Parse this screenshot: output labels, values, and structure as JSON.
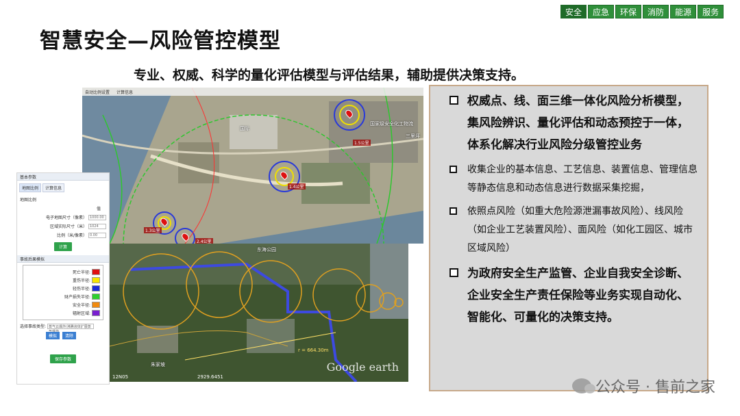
{
  "tabs": [
    "安全",
    "应急",
    "环保",
    "消防",
    "能源",
    "服务"
  ],
  "title": "智慧安全—风险管控模型",
  "subtitle": "专业、权威、科学的量化评估模型与评估结果，辅助提供决策支持。",
  "map_top": {
    "toolbar": [
      "自动比例设置",
      "计算信息"
    ],
    "labels": [
      "1.5公里",
      "1.4公里",
      "1.3公里",
      "2.4公里"
    ],
    "places": [
      "国家级安全化工物流",
      "国际",
      "三里坪"
    ]
  },
  "map_bottom": {
    "places": [
      "朱家坡",
      "东海公园"
    ],
    "distance": "r = 664.30m",
    "scale": "2929.6451",
    "coord": "12N05",
    "google": "Google earth"
  },
  "panel": {
    "header": "基本参数",
    "tabs": [
      "地图比例",
      "计算信息"
    ],
    "section": "地图比例",
    "col_label": "值",
    "rows": [
      {
        "label": "电子地图尺寸（像素）",
        "value": "1000.00"
      },
      {
        "label": "区域实际尺寸（米）",
        "value": "1024"
      },
      {
        "label": "比例（米/像素）",
        "value": "0.00"
      }
    ],
    "apply_btn": "计算",
    "legend_header": "事故后果模拟",
    "legend": [
      {
        "label": "死亡半径:",
        "color": "#e01010"
      },
      {
        "label": "重伤半径:",
        "color": "#f5e400"
      },
      {
        "label": "轻伤半径:",
        "color": "#1a2ad8"
      },
      {
        "label": "财产损失半径:",
        "color": "#2fd02f"
      },
      {
        "label": "安全半径:",
        "color": "#f08a10"
      },
      {
        "label": "辐射区域:",
        "color": "#7a1fd0"
      }
    ],
    "select_label": "选择事故类型:",
    "select_value": "蒸气云爆炸/沸腾液体扩展蒸气爆炸",
    "btn_a": "模拟",
    "btn_b": "清除",
    "save_btn": "保存参数"
  },
  "bullets": [
    {
      "text": "权威点、线、面三维一体化风险分析模型，集风险辨识、量化评估和动态预控于一体，体系化解决行业风险分级管控业务",
      "style": "big"
    },
    {
      "text": "收集企业的基本信息、工艺信息、装置信息、管理信息等静态信息和动态信息进行数据采集挖掘，",
      "style": "small"
    },
    {
      "text": "依照点风险（如重大危险源泄漏事故风险）、线风险（如企业工艺装置风险）、面风险（如化工园区、城市区域风险）",
      "style": "small"
    },
    {
      "text": "为政府安全生产监管、企业自我安全诊断、企业安全生产责任保险等业务实现自动化、智能化、可量化的决策支持。",
      "style": "big"
    }
  ],
  "watermark": "公众号 · 售前之家"
}
